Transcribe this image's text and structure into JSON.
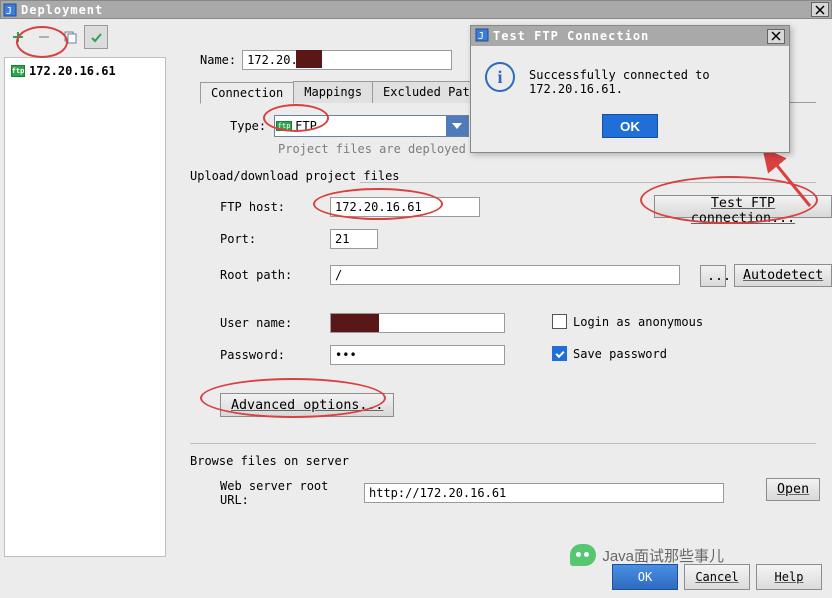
{
  "window": {
    "title": "Deployment",
    "close_x": "✕"
  },
  "toolbar": {
    "add_glyph": "+",
    "remove_glyph": "−",
    "copy_glyph": "⧉",
    "default_glyph": "✔"
  },
  "tree": {
    "item0": {
      "icon_label": "ftp",
      "label": "172.20.16.61"
    }
  },
  "name": {
    "label": "Name:",
    "value": "172.20.16."
  },
  "tabs": {
    "t0": "Connection",
    "t1": "Mappings",
    "t2": "Excluded Paths"
  },
  "type": {
    "label": "Type:",
    "value": "FTP",
    "icon_label": "ftp"
  },
  "help": "Project files are deployed to a remote",
  "sections": {
    "upload": "Upload/download project files",
    "browse": "Browse files on server"
  },
  "fields": {
    "host": {
      "label": "FTP host:",
      "value": "172.20.16.61"
    },
    "port": {
      "label": "Port:",
      "value": "21"
    },
    "root": {
      "label": "Root path:",
      "value": "/"
    },
    "user": {
      "label": "User name:",
      "value": ""
    },
    "pass": {
      "label": "Password:",
      "value": "•••"
    },
    "url": {
      "label": "Web server root URL:",
      "value": "http://172.20.16.61"
    }
  },
  "checks": {
    "anon": {
      "label": "Login as anonymous",
      "checked": false
    },
    "save": {
      "label": "Save password",
      "checked": true
    }
  },
  "buttons": {
    "test": "Test FTP connection...",
    "browse_root": "...",
    "autodetect": "Autodetect",
    "advanced": "Advanced options...",
    "open": "Open",
    "ok": "OK",
    "cancel": "Cancel",
    "help": "Help"
  },
  "popup": {
    "title": "Test FTP Connection",
    "message": "Successfully connected to 172.20.16.61.",
    "ok": "OK",
    "close_x": "✕"
  },
  "watermark": "Java面试那些事儿"
}
